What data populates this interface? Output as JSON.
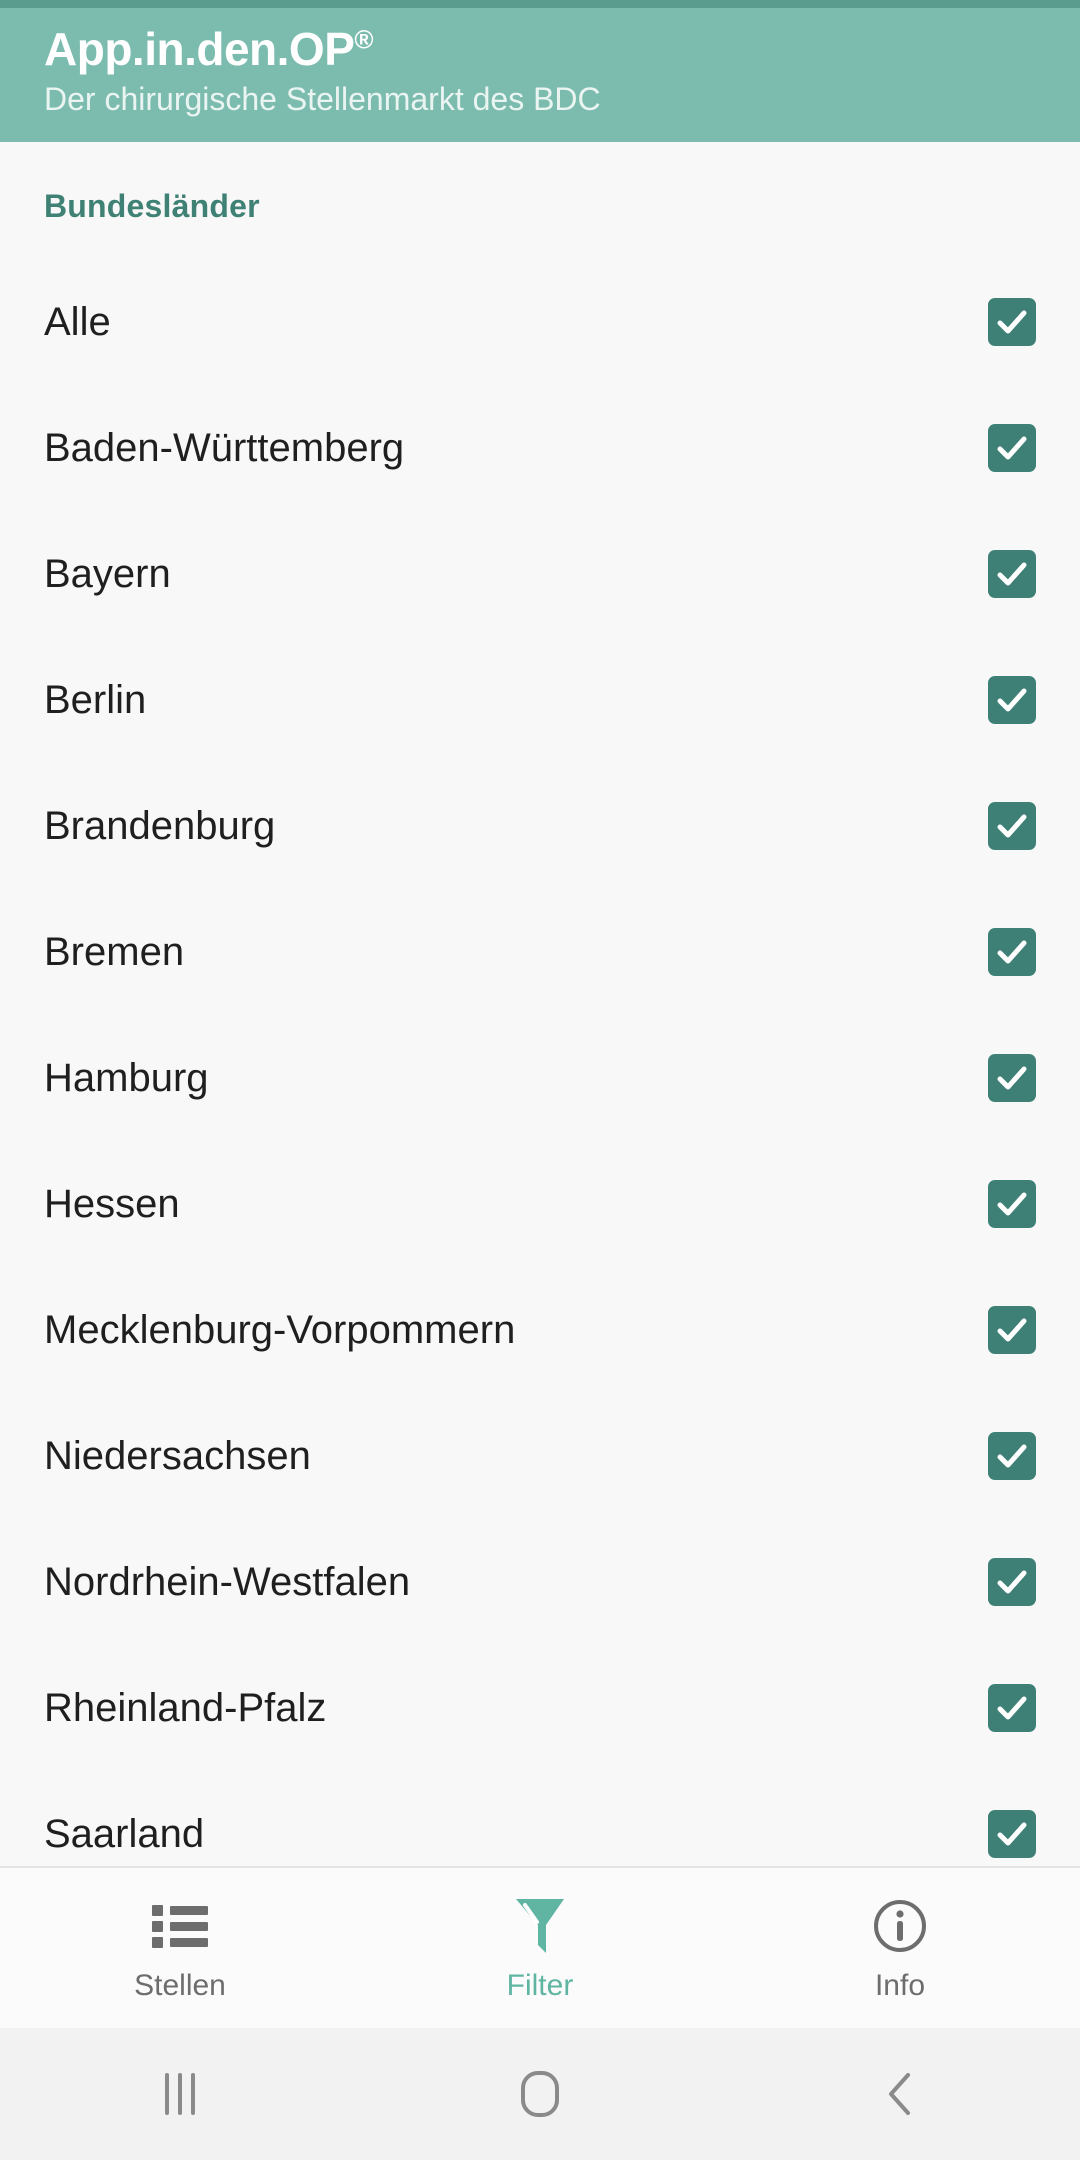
{
  "header": {
    "title": "App.in.den.OP",
    "trademark": "®",
    "subtitle": "Der chirurgische Stellenmarkt des BDC",
    "background_color": "#7cbcaf",
    "status_strip_color": "#5a9c8d"
  },
  "filter_screen": {
    "section_title": "Bundesländer",
    "section_title_color": "#3f8174",
    "checkbox_color": "#3e8075",
    "items": [
      {
        "label": "Alle",
        "checked": true
      },
      {
        "label": "Baden-Württemberg",
        "checked": true
      },
      {
        "label": "Bayern",
        "checked": true
      },
      {
        "label": "Berlin",
        "checked": true
      },
      {
        "label": "Brandenburg",
        "checked": true
      },
      {
        "label": "Bremen",
        "checked": true
      },
      {
        "label": "Hamburg",
        "checked": true
      },
      {
        "label": "Hessen",
        "checked": true
      },
      {
        "label": "Mecklenburg-Vorpommern",
        "checked": true
      },
      {
        "label": "Niedersachsen",
        "checked": true
      },
      {
        "label": "Nordrhein-Westfalen",
        "checked": true
      },
      {
        "label": "Rheinland-Pfalz",
        "checked": true
      },
      {
        "label": "Saarland",
        "checked": true
      }
    ]
  },
  "tabbar": {
    "active_color": "#5fb5a2",
    "inactive_color": "#6d6d6d",
    "tabs": [
      {
        "label": "Stellen",
        "icon": "list-icon",
        "active": false
      },
      {
        "label": "Filter",
        "icon": "funnel-icon",
        "active": true
      },
      {
        "label": "Info",
        "icon": "info-circle-icon",
        "active": false
      }
    ]
  },
  "navbar": {
    "buttons": [
      {
        "icon": "recents-icon"
      },
      {
        "icon": "home-icon"
      },
      {
        "icon": "back-icon"
      }
    ]
  }
}
